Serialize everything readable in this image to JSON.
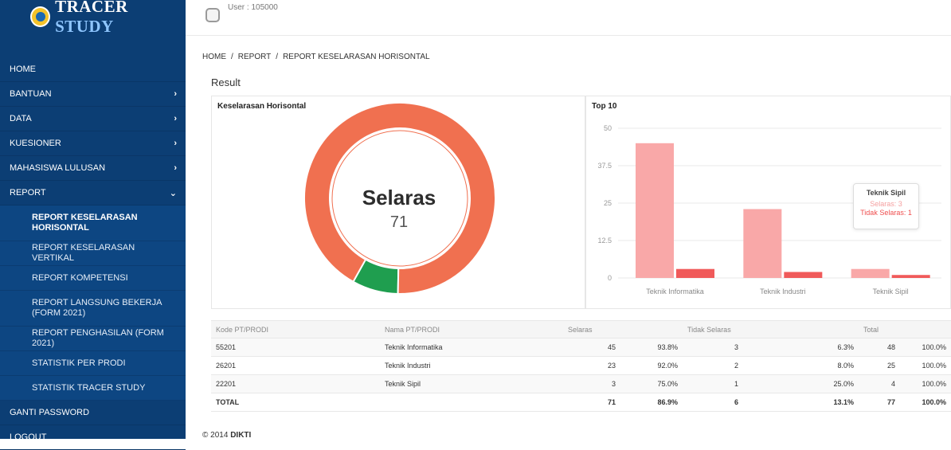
{
  "brand": {
    "name_main": "TRACER",
    "name_accent": "STUDY"
  },
  "topbar": {
    "user": "User : 105000"
  },
  "sidebar": {
    "items": [
      {
        "label": "HOME",
        "chevron": ""
      },
      {
        "label": "BANTUAN",
        "chevron": "›"
      },
      {
        "label": "DATA",
        "chevron": "›"
      },
      {
        "label": "KUESIONER",
        "chevron": "›"
      },
      {
        "label": "MAHASISWA LULUSAN",
        "chevron": "›"
      },
      {
        "label": "REPORT",
        "chevron": "⌄"
      }
    ],
    "report_sub": [
      "REPORT KESELARASAN HORISONTAL",
      "REPORT KESELARASAN VERTIKAL",
      "REPORT KOMPETENSI",
      "REPORT LANGSUNG BEKERJA (FORM 2021)",
      "REPORT PENGHASILAN (FORM 2021)",
      "STATISTIK PER PRODI",
      "STATISTIK TRACER STUDY"
    ],
    "bottom": [
      "GANTI PASSWORD",
      "LOGOUT"
    ]
  },
  "breadcrumb": [
    "HOME",
    "REPORT",
    "REPORT KESELARASAN HORISONTAL"
  ],
  "breadcrumb_sep": "/",
  "result_title": "Result",
  "left_panel": {
    "title": "Keselarasan Horisontal",
    "center_label": "Selaras",
    "center_value": "71"
  },
  "right_panel": {
    "title": "Top 10"
  },
  "tooltip": {
    "title": "Teknik Sipil",
    "line1": "Selaras: 3",
    "line2": "Tidak Selaras: 1"
  },
  "colors": {
    "selaras_donut": "#f07050",
    "tidak_donut": "#1f9e4f",
    "bar_selaras": "#f9a8a8",
    "bar_tidak": "#f05a5a",
    "sidebar": "#0c3e74"
  },
  "chart_data": [
    {
      "type": "pie",
      "title": "Keselarasan Horisontal",
      "labels": [
        "Selaras",
        "Tidak Selaras"
      ],
      "values": [
        71,
        6
      ]
    },
    {
      "type": "bar",
      "title": "Top 10",
      "categories": [
        "Teknik Informatika",
        "Teknik Industri",
        "Teknik Sipil"
      ],
      "series": [
        {
          "name": "Selaras",
          "values": [
            45,
            23,
            3
          ]
        },
        {
          "name": "Tidak Selaras",
          "values": [
            3,
            2,
            1
          ]
        }
      ],
      "yticks": [
        "0",
        "12.5",
        "25",
        "37.5",
        "50"
      ],
      "ylim": [
        0,
        50
      ],
      "grid": true
    }
  ],
  "table": {
    "headers": [
      "Kode PT/PRODI",
      "Nama PT/PRODI",
      "Selaras",
      "",
      "Tidak Selaras",
      "",
      "Total",
      ""
    ],
    "rows": [
      [
        "55201",
        "Teknik Informatika",
        "45",
        "93.8%",
        "3",
        "6.3%",
        "48",
        "100.0%"
      ],
      [
        "26201",
        "Teknik Industri",
        "23",
        "92.0%",
        "2",
        "8.0%",
        "25",
        "100.0%"
      ],
      [
        "22201",
        "Teknik Sipil",
        "3",
        "75.0%",
        "1",
        "25.0%",
        "4",
        "100.0%"
      ]
    ],
    "total": [
      "TOTAL",
      "",
      "71",
      "86.9%",
      "6",
      "13.1%",
      "77",
      "100.0%"
    ]
  },
  "footer": {
    "prefix": "© 2014",
    "org": "DIKTI"
  }
}
